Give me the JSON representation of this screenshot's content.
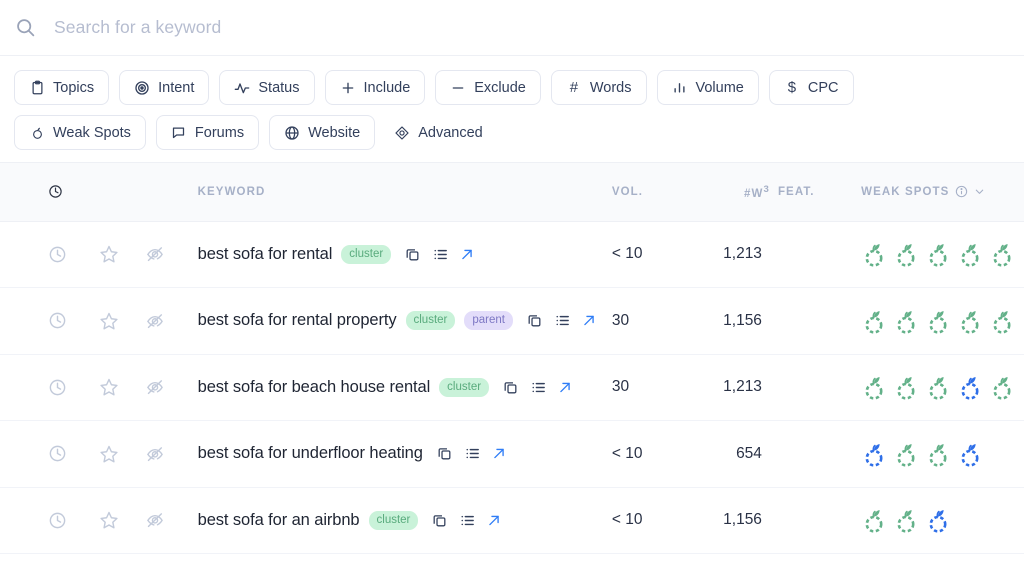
{
  "search": {
    "placeholder": "Search for a keyword",
    "value": "",
    "icon": "search-icon"
  },
  "filters": {
    "row1": [
      {
        "label": "Topics",
        "icon": "clipboard-icon"
      },
      {
        "label": "Intent",
        "icon": "target-icon"
      },
      {
        "label": "Status",
        "icon": "activity-pulse-icon"
      },
      {
        "label": "Include",
        "icon": "plus-icon"
      },
      {
        "label": "Exclude",
        "icon": "minus-icon"
      },
      {
        "label": "Words",
        "icon": "hash-icon"
      },
      {
        "label": "Volume",
        "icon": "bar-chart-icon"
      },
      {
        "label": "CPC",
        "icon": "dollar-icon"
      }
    ],
    "row2": [
      {
        "label": "Weak Spots",
        "icon": "peach-icon"
      },
      {
        "label": "Forums",
        "icon": "message-square-icon"
      },
      {
        "label": "Website",
        "icon": "globe-icon"
      },
      {
        "label": "Advanced",
        "icon": "cube-icon",
        "borderless": true
      }
    ]
  },
  "table": {
    "headers": {
      "keyword": "KEYWORD",
      "volume": "VOL.",
      "words": "#W",
      "words_sup": "3",
      "feat": "FEAT.",
      "weak_spots": "WEAK SPOTS"
    },
    "rows": [
      {
        "keyword": "best sofa for rental",
        "badges": [
          "cluster"
        ],
        "volume": "< 10",
        "words": "1,213",
        "feat": "",
        "weak_spots": [
          "green",
          "green",
          "green",
          "green",
          "green"
        ]
      },
      {
        "keyword": "best sofa for rental property",
        "badges": [
          "cluster",
          "parent"
        ],
        "volume": "30",
        "words": "1,156",
        "feat": "",
        "weak_spots": [
          "green",
          "green",
          "green",
          "green",
          "green"
        ]
      },
      {
        "keyword": "best sofa for beach house rental",
        "badges": [
          "cluster"
        ],
        "volume": "30",
        "words": "1,213",
        "feat": "",
        "weak_spots": [
          "green",
          "green",
          "green",
          "blue",
          "green"
        ]
      },
      {
        "keyword": "best sofa for underfloor heating",
        "badges": [],
        "volume": "< 10",
        "words": "654",
        "feat": "",
        "weak_spots": [
          "blue",
          "green",
          "green",
          "blue"
        ]
      },
      {
        "keyword": "best sofa for an airbnb",
        "badges": [
          "cluster"
        ],
        "volume": "< 10",
        "words": "1,156",
        "feat": "",
        "weak_spots": [
          "green",
          "green",
          "blue"
        ]
      }
    ]
  },
  "colors": {
    "spot_green": "#63b189",
    "spot_blue": "#2f6fe8",
    "badge_cluster_bg": "#c9f2d9",
    "badge_cluster_fg": "#59ab7d",
    "badge_parent_bg": "#e3ddfa",
    "badge_parent_fg": "#7d77c4",
    "link_blue": "#2f7df6",
    "header_text": "#a6b0c7"
  }
}
